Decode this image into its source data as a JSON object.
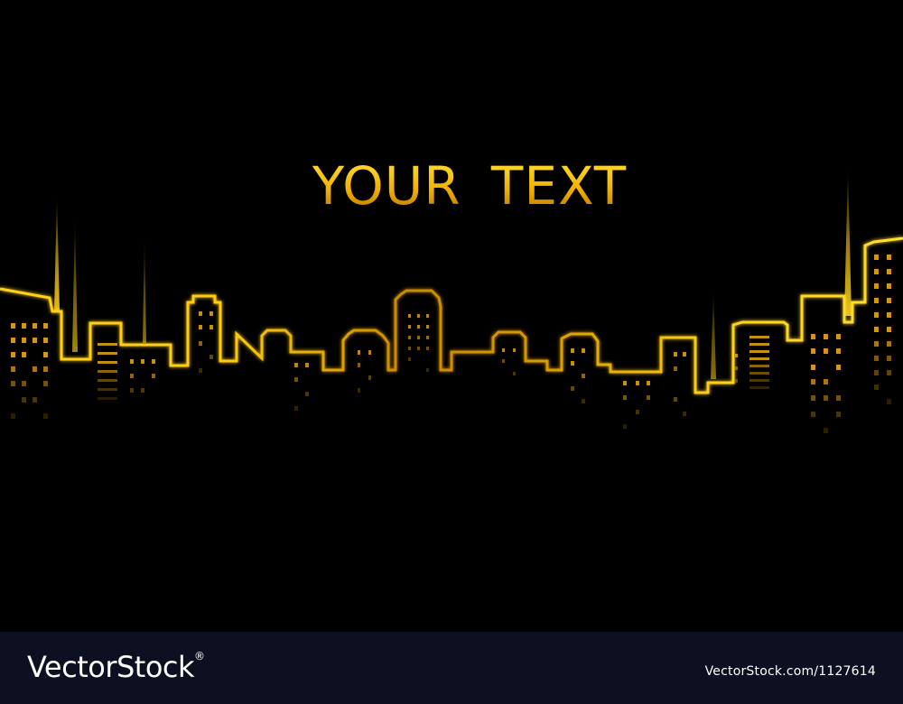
{
  "headline": {
    "text": "YOUR TEXT"
  },
  "footer": {
    "brand": "VectorStock",
    "brand_mark": "®",
    "image_id": "VectorStock.com/1127614"
  },
  "colors": {
    "background": "#000000",
    "neon_yellow": "#ffd21a",
    "neon_orange": "#c98a00",
    "footer_bg": "#0c1020"
  }
}
